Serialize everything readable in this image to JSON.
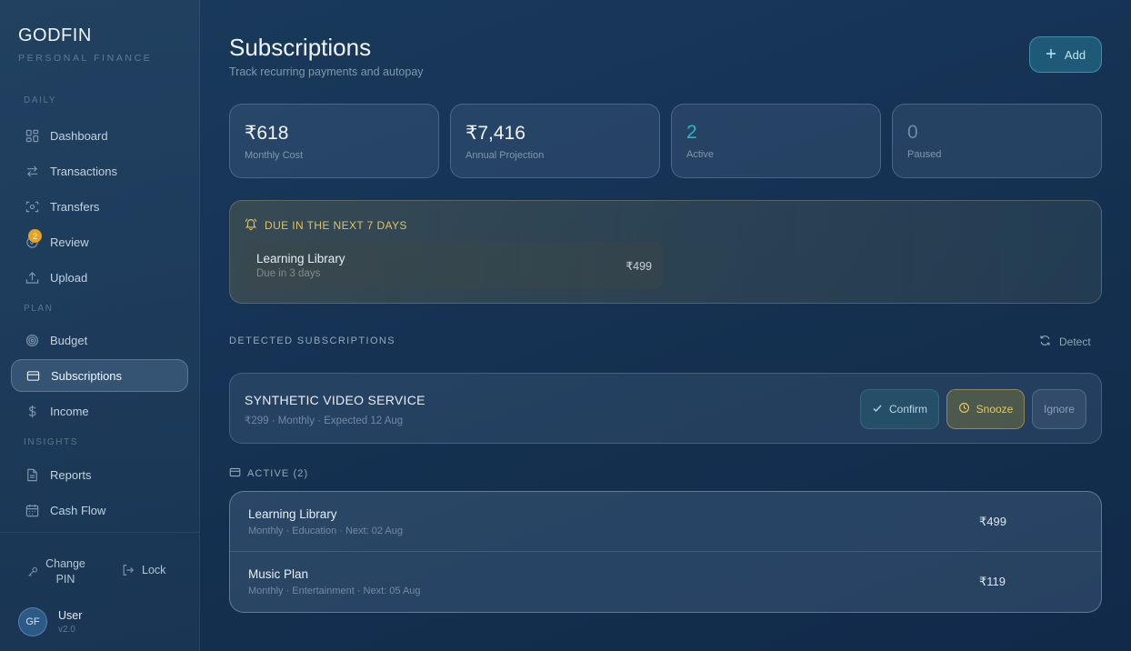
{
  "brand": {
    "name": "GODFIN",
    "tagline": "PERSONAL FINANCE"
  },
  "nav": {
    "sections": [
      {
        "label": "DAILY"
      },
      {
        "label": "PLAN"
      },
      {
        "label": "INSIGHTS"
      }
    ],
    "items": [
      {
        "label": "Dashboard",
        "icon": "grid-icon"
      },
      {
        "label": "Transactions",
        "icon": "arrows-icon"
      },
      {
        "label": "Transfers",
        "icon": "scan-icon"
      },
      {
        "label": "Review",
        "icon": "review-icon",
        "badge": "2"
      },
      {
        "label": "Upload",
        "icon": "upload-icon"
      },
      {
        "label": "Budget",
        "icon": "target-icon"
      },
      {
        "label": "Subscriptions",
        "icon": "card-icon",
        "active": true
      },
      {
        "label": "Income",
        "icon": "dollar-icon"
      },
      {
        "label": "Reports",
        "icon": "document-icon"
      },
      {
        "label": "Cash Flow",
        "icon": "calendar-icon"
      }
    ]
  },
  "footer": {
    "change_pin": "Change PIN",
    "lock": "Lock",
    "user": {
      "initials": "GF",
      "name": "User",
      "version": "v2.0"
    }
  },
  "header": {
    "title": "Subscriptions",
    "subtitle": "Track recurring payments and autopay",
    "add_label": "Add"
  },
  "stats": [
    {
      "value": "₹618",
      "label": "Monthly Cost"
    },
    {
      "value": "₹7,416",
      "label": "Annual Projection"
    },
    {
      "value": "2",
      "label": "Active"
    },
    {
      "value": "0",
      "label": "Paused"
    }
  ],
  "due": {
    "heading": "DUE IN THE NEXT 7 DAYS",
    "items": [
      {
        "name": "Learning Library",
        "meta": "Due in 3 days",
        "amount": "₹499"
      }
    ]
  },
  "detected": {
    "heading": "DETECTED SUBSCRIPTIONS",
    "detect_label": "Detect",
    "items": [
      {
        "name": "SYNTHETIC VIDEO SERVICE",
        "meta": "₹299 · Monthly · Expected 12 Aug",
        "confirm_label": "Confirm",
        "snooze_label": "Snooze",
        "ignore_label": "Ignore"
      }
    ]
  },
  "active": {
    "heading": "ACTIVE (2)",
    "items": [
      {
        "name": "Learning Library",
        "meta": "Monthly · Education · Next: 02 Aug",
        "amount": "₹499"
      },
      {
        "name": "Music Plan",
        "meta": "Monthly · Entertainment · Next: 05 Aug",
        "amount": "₹119"
      }
    ]
  },
  "colors": {
    "accent": "#2fb3c9",
    "warning": "#e1c15e",
    "badge": "#e8a21b"
  }
}
